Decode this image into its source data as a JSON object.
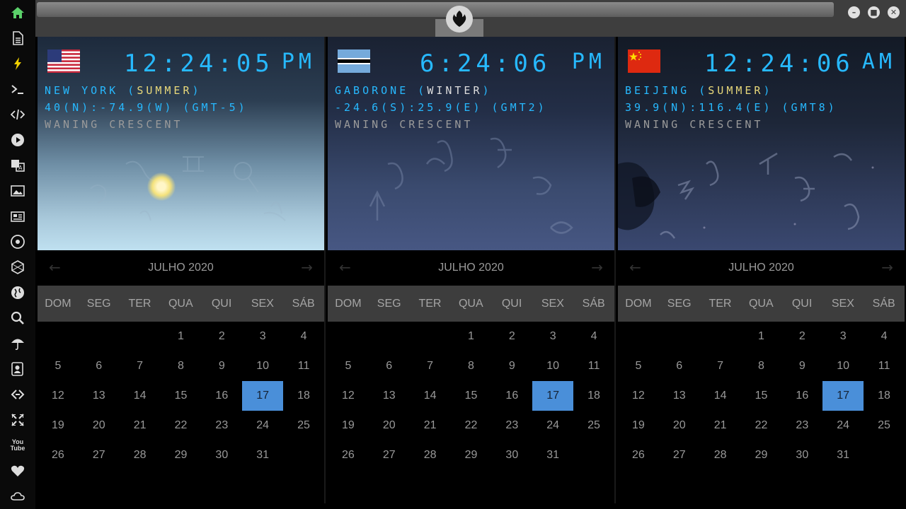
{
  "sidebar": {
    "icons": [
      "home-icon",
      "document-icon",
      "bolt-icon",
      "terminal-icon",
      "code-icon",
      "play-icon",
      "translate-icon",
      "image-icon",
      "news-icon",
      "rebel-icon",
      "hexagon-icon",
      "globe-icon",
      "search-icon",
      "umbrella-icon",
      "contacts-icon",
      "link-icon",
      "expand-icon",
      "youtube-icon",
      "heart-icon",
      "cloud-icon"
    ],
    "youtube_label": "You Tube"
  },
  "window": {
    "minimize": "–",
    "maximize": "■",
    "close": "✕"
  },
  "panels": [
    {
      "time": "12:24:05",
      "ampm": "PM",
      "city": "NEW YORK",
      "season": "SUMMER",
      "coords": "40(N):-74.9(W) (GMT-5)",
      "moon": "WANING CRESCENT",
      "flag": "usa"
    },
    {
      "time": "6:24:06",
      "ampm": "PM",
      "city": "GABORONE",
      "season": "WINTER",
      "coords": "-24.6(S):25.9(E) (GMT2)",
      "moon": "WANING CRESCENT",
      "flag": "botswana"
    },
    {
      "time": "12:24:06",
      "ampm": "AM",
      "city": "BEIJING",
      "season": "SUMMER",
      "coords": "39.9(N):116.4(E) (GMT8)",
      "moon": "WANING CRESCENT",
      "flag": "china"
    }
  ],
  "calendar": {
    "month_label": "JULHO 2020",
    "prev": "←",
    "next": "→",
    "weekdays": [
      "DOM",
      "SEG",
      "TER",
      "QUA",
      "QUI",
      "SEX",
      "SÁB"
    ],
    "first_weekday_index": 3,
    "days_in_month": 31,
    "today": 17
  },
  "colors": {
    "accent": "#27b9ff",
    "today": "#4a8fd9",
    "season": "#e8d87a"
  }
}
